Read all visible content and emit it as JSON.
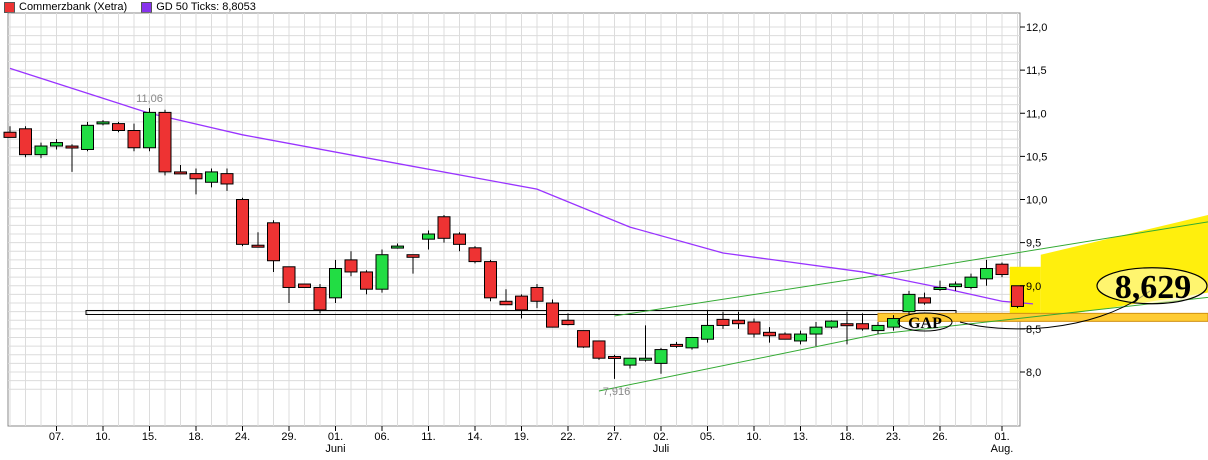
{
  "legend": {
    "series1": "Commerzbank (Xetra)",
    "series2": "GD 50 Ticks: 8,8053"
  },
  "colors": {
    "up": "#22dd44",
    "down": "#ee3333",
    "ma": "#9933ff",
    "channel": "#33aa33",
    "yellow": "#ffee00",
    "gap_bar": "#ffcc33",
    "grid": "#dcdcdc"
  },
  "chart_data": {
    "type": "candlestick",
    "title": "",
    "ylim": [
      7.8,
      12.05
    ],
    "y_ticks": [
      "8,0",
      "8,5",
      "9,0",
      "9,5",
      "10,0",
      "10,5",
      "11,0",
      "11,5",
      "12,0"
    ],
    "y_tick_values": [
      8.0,
      8.5,
      9.0,
      9.5,
      10.0,
      10.5,
      11.0,
      11.5,
      12.0
    ],
    "x_tick_labels": [
      "07.",
      "10.",
      "15.",
      "18.",
      "24.",
      "29.",
      "01.",
      "06.",
      "11.",
      "14.",
      "19.",
      "22.",
      "27.",
      "02.",
      "05.",
      "10.",
      "13.",
      "18.",
      "23.",
      "26.",
      "01."
    ],
    "x_tick_index": [
      3,
      6,
      9,
      12,
      15,
      18,
      21,
      24,
      27,
      30,
      33,
      36,
      39,
      42,
      45,
      48,
      51,
      54,
      57,
      60,
      64
    ],
    "month_labels": [
      "Juni",
      "Juli",
      "Aug."
    ],
    "month_index": [
      21,
      42,
      64
    ],
    "candles": [
      [
        10.78,
        10.85,
        10.72,
        10.72
      ],
      [
        10.82,
        10.85,
        10.49,
        10.52
      ],
      [
        10.52,
        10.66,
        10.48,
        10.62
      ],
      [
        10.62,
        10.7,
        10.58,
        10.66
      ],
      [
        10.62,
        10.64,
        10.32,
        10.6
      ],
      [
        10.58,
        10.9,
        10.56,
        10.86
      ],
      [
        10.88,
        10.92,
        10.86,
        10.9
      ],
      [
        10.88,
        10.9,
        10.78,
        10.8
      ],
      [
        10.8,
        10.88,
        10.56,
        10.6
      ],
      [
        10.6,
        11.06,
        10.56,
        11.01
      ],
      [
        11.01,
        11.04,
        10.28,
        10.32
      ],
      [
        10.32,
        10.4,
        10.3,
        10.3
      ],
      [
        10.3,
        10.36,
        10.06,
        10.24
      ],
      [
        10.2,
        10.36,
        10.14,
        10.32
      ],
      [
        10.3,
        10.36,
        10.1,
        10.18
      ],
      [
        10.0,
        10.02,
        9.46,
        9.48
      ],
      [
        9.47,
        9.62,
        9.46,
        9.46
      ],
      [
        9.73,
        9.76,
        9.16,
        9.29
      ],
      [
        9.22,
        9.22,
        8.8,
        8.98
      ],
      [
        9.02,
        9.02,
        8.98,
        8.98
      ],
      [
        8.98,
        9.02,
        8.68,
        8.72
      ],
      [
        8.86,
        9.3,
        8.8,
        9.2
      ],
      [
        9.3,
        9.4,
        9.11,
        9.16
      ],
      [
        9.16,
        9.18,
        8.9,
        8.96
      ],
      [
        8.96,
        9.42,
        8.92,
        9.36
      ],
      [
        9.46,
        9.49,
        9.43,
        9.46
      ],
      [
        9.36,
        9.36,
        9.14,
        9.33
      ],
      [
        9.54,
        9.64,
        9.42,
        9.6
      ],
      [
        9.8,
        9.82,
        9.5,
        9.55
      ],
      [
        9.6,
        9.62,
        9.4,
        9.48
      ],
      [
        9.44,
        9.46,
        9.26,
        9.28
      ],
      [
        9.28,
        9.3,
        8.82,
        8.86
      ],
      [
        8.82,
        8.96,
        8.78,
        8.78
      ],
      [
        8.88,
        8.9,
        8.62,
        8.72
      ],
      [
        8.98,
        9.02,
        8.74,
        8.82
      ],
      [
        8.8,
        8.84,
        8.52,
        8.52
      ],
      [
        8.6,
        8.68,
        8.54,
        8.55
      ],
      [
        8.48,
        8.48,
        8.28,
        8.29
      ],
      [
        8.36,
        8.36,
        8.14,
        8.16
      ],
      [
        8.18,
        8.2,
        7.92,
        8.16
      ],
      [
        8.08,
        8.16,
        8.04,
        8.16
      ],
      [
        8.16,
        8.54,
        8.12,
        8.16
      ],
      [
        8.1,
        8.28,
        7.98,
        8.26
      ],
      [
        8.32,
        8.35,
        8.28,
        8.3
      ],
      [
        8.28,
        8.36,
        8.26,
        8.4
      ],
      [
        8.38,
        8.72,
        8.34,
        8.54
      ],
      [
        8.61,
        8.7,
        8.5,
        8.54
      ],
      [
        8.6,
        8.7,
        8.5,
        8.56
      ],
      [
        8.58,
        8.62,
        8.4,
        8.44
      ],
      [
        8.46,
        8.52,
        8.34,
        8.42
      ],
      [
        8.44,
        8.46,
        8.38,
        8.38
      ],
      [
        8.36,
        8.48,
        8.32,
        8.44
      ],
      [
        8.44,
        8.58,
        8.3,
        8.52
      ],
      [
        8.52,
        8.6,
        8.5,
        8.59
      ],
      [
        8.56,
        8.7,
        8.32,
        8.54
      ],
      [
        8.56,
        8.68,
        8.48,
        8.5
      ],
      [
        8.48,
        8.58,
        8.44,
        8.54
      ],
      [
        8.52,
        8.66,
        8.48,
        8.62
      ],
      [
        8.7,
        8.94,
        8.66,
        8.9
      ],
      [
        8.86,
        8.92,
        8.78,
        8.8
      ],
      [
        8.97,
        9.06,
        8.94,
        8.98
      ],
      [
        8.99,
        9.05,
        8.94,
        9.02
      ],
      [
        8.98,
        9.14,
        8.96,
        9.1
      ],
      [
        9.08,
        9.3,
        9.0,
        9.2
      ],
      [
        9.25,
        9.27,
        9.1,
        9.13
      ],
      [
        9.0,
        9.0,
        8.74,
        8.76
      ]
    ],
    "ma_series": {
      "name": "GD 50 Ticks: 8,8053",
      "points": [
        [
          0,
          11.52
        ],
        [
          9,
          11.0
        ],
        [
          15,
          10.75
        ],
        [
          24,
          10.45
        ],
        [
          34,
          10.12
        ],
        [
          40,
          9.68
        ],
        [
          46,
          9.38
        ],
        [
          55,
          9.16
        ],
        [
          60,
          8.98
        ],
        [
          64,
          8.82
        ],
        [
          66,
          8.79
        ]
      ]
    },
    "annotations": {
      "high_label": "11,06",
      "low_label": "7,916",
      "gap_label": "GAP",
      "price_label": "8,629"
    },
    "level_line": 8.69,
    "channel_upper": [
      [
        39,
        8.65
      ],
      [
        56,
        9.12
      ],
      [
        80,
        9.82
      ]
    ],
    "channel_lower": [
      [
        38,
        7.78
      ],
      [
        56,
        8.44
      ],
      [
        80,
        8.92
      ]
    ]
  }
}
